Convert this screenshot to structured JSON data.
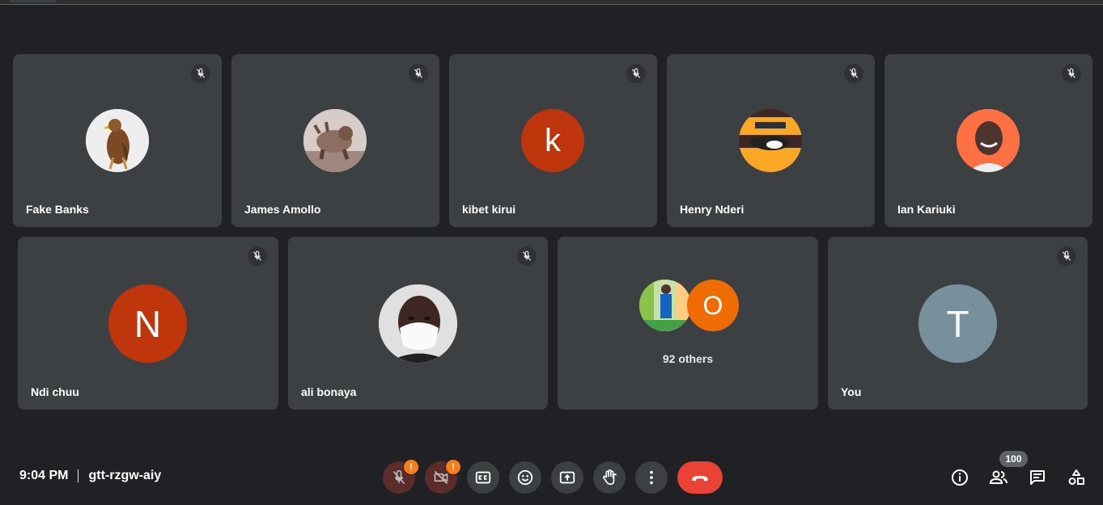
{
  "meeting": {
    "time": "9:04 PM",
    "code": "gtt-rzgw-aiy",
    "participant_count": "100"
  },
  "participants": [
    {
      "name": "Fake Banks",
      "avatar_type": "photo",
      "avatar_desc": "hawk-photo",
      "muted": true
    },
    {
      "name": "James Amollo",
      "avatar_type": "photo",
      "avatar_desc": "bull-statue-photo",
      "muted": true
    },
    {
      "name": "kibet kirui",
      "avatar_type": "letter",
      "initial": "k",
      "color": "#bf360c",
      "muted": true
    },
    {
      "name": "Henry Nderi",
      "avatar_type": "photo",
      "avatar_desc": "cat-photo",
      "muted": true
    },
    {
      "name": "Ian Kariuki",
      "avatar_type": "photo",
      "avatar_desc": "smiling-man-photo",
      "muted": true
    },
    {
      "name": "Ndi chuu",
      "avatar_type": "letter",
      "initial": "N",
      "color": "#bf360c",
      "muted": true
    },
    {
      "name": "ali bonaya",
      "avatar_type": "photo",
      "avatar_desc": "masked-man-photo",
      "muted": true
    },
    {
      "name": "You",
      "avatar_type": "letter",
      "initial": "T",
      "color": "#78909c",
      "muted": true
    }
  ],
  "others_tile": {
    "label": "92 others",
    "initial": "O",
    "color": "#ef6c00"
  },
  "controls": {
    "mic": {
      "icon": "mic-off-icon",
      "warning": "!"
    },
    "camera": {
      "icon": "videocam-off-icon",
      "warning": "!"
    },
    "captions": {
      "icon": "closed-caption-icon"
    },
    "reactions": {
      "icon": "emoji-icon"
    },
    "present": {
      "icon": "present-screen-icon"
    },
    "raise_hand": {
      "icon": "hand-icon"
    },
    "more": {
      "icon": "more-vert-icon"
    },
    "leave": {
      "icon": "call-end-icon",
      "color": "#ea4335"
    }
  },
  "side_controls": [
    "info-icon",
    "people-icon",
    "chat-icon",
    "activities-icon"
  ],
  "colors": {
    "background": "#202124",
    "tile": "#3c4043",
    "warning": "#fa7b17"
  }
}
